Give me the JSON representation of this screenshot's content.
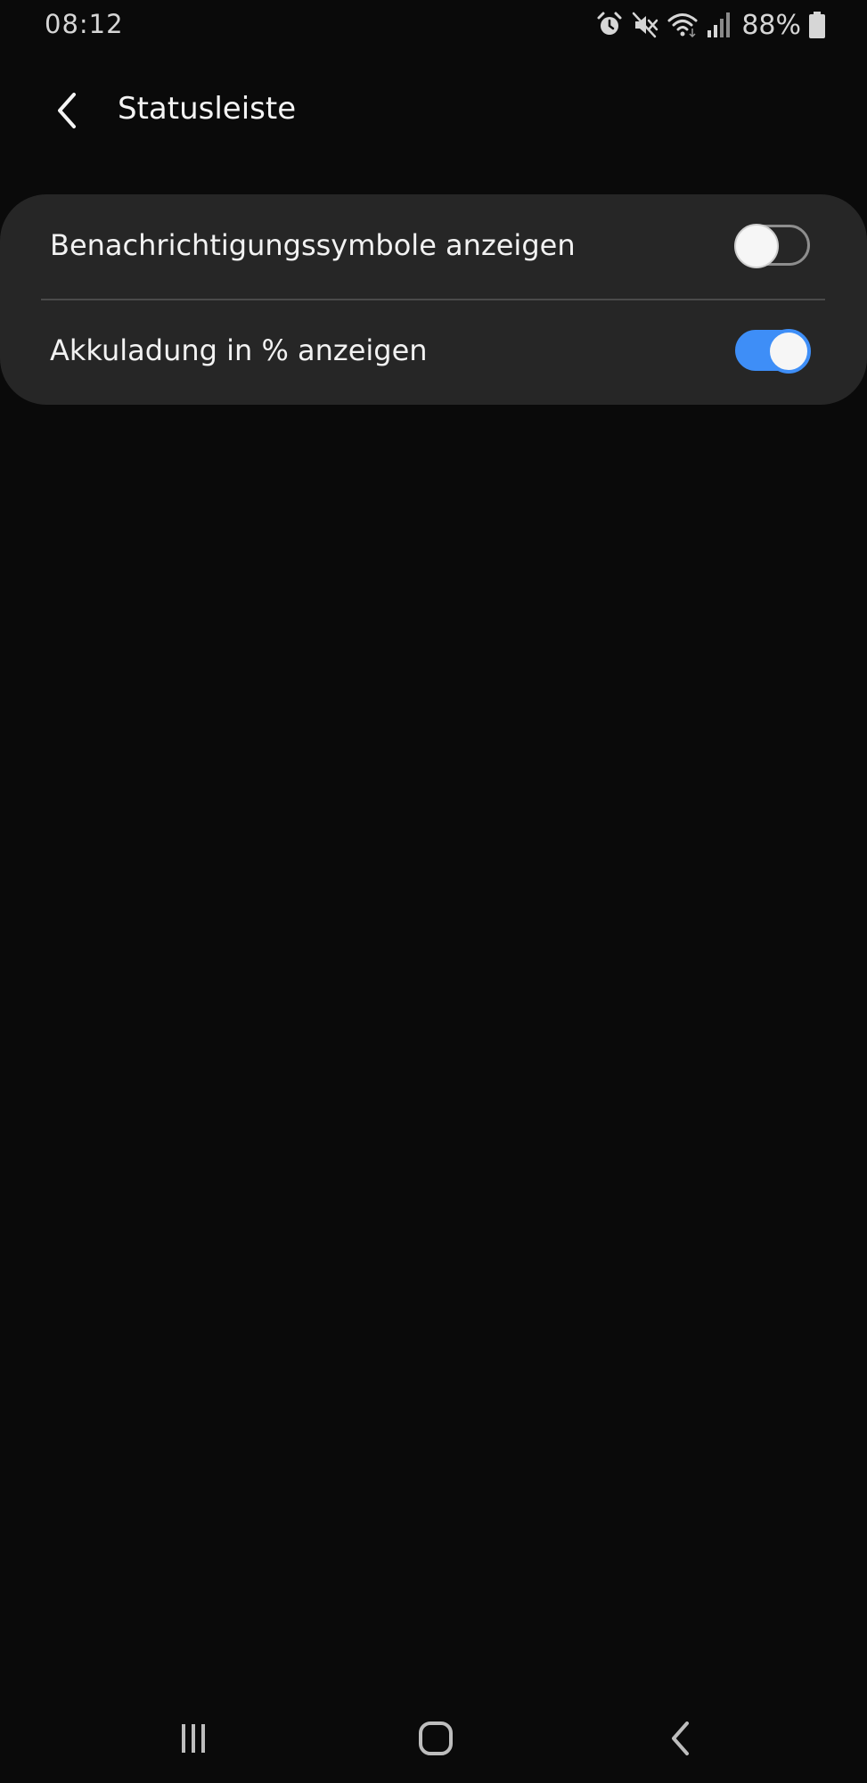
{
  "status_bar": {
    "time": "08:12",
    "battery_percent": "88%",
    "icons": [
      "alarm-icon",
      "mute-icon",
      "wifi-icon",
      "signal-icon",
      "battery-icon"
    ]
  },
  "header": {
    "title": "Statusleiste",
    "back_icon": "chevron-left-icon"
  },
  "settings": {
    "items": [
      {
        "label": "Benachrichtigungssymbole anzeigen",
        "enabled": false
      },
      {
        "label": "Akkuladung in % anzeigen",
        "enabled": true
      }
    ]
  },
  "nav_bar": {
    "buttons": [
      "recent-apps-icon",
      "home-icon",
      "back-icon"
    ]
  },
  "colors": {
    "background": "#0a0a0a",
    "card": "#262626",
    "accent": "#3e8ef7"
  }
}
